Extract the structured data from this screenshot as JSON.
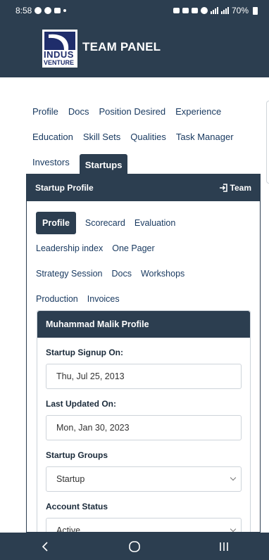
{
  "status_bar": {
    "time": "8:58",
    "battery": "70%"
  },
  "header": {
    "logo_line1": "INDUS",
    "logo_line2": "VENTURE",
    "title": "TEAM PANEL",
    "brand_color": "#2c3e50"
  },
  "top_tabs": {
    "row1": [
      "Profile",
      "Docs",
      "Position Desired",
      "Experience"
    ],
    "row2": [
      "Education",
      "Skill Sets",
      "Qualities",
      "Task Manager"
    ],
    "row3": [
      "Investors",
      "Startups"
    ],
    "active": "Startups"
  },
  "panel": {
    "title": "Startup Profile",
    "team_link": "Team"
  },
  "sub_tabs": {
    "row1": [
      "Profile",
      "Scorecard",
      "Evaluation"
    ],
    "row2": [
      "Leadership index",
      "One Pager"
    ],
    "row3": [
      "Strategy Session",
      "Docs",
      "Workshops"
    ],
    "row4": [
      "Production",
      "Invoices"
    ],
    "active": "Profile"
  },
  "card": {
    "title": "Muhammad Malik Profile",
    "fields": [
      {
        "label": "Startup Signup On:",
        "value": "Thu, Jul 25, 2013"
      },
      {
        "label": "Last Updated On:",
        "value": "Mon, Jan 30, 2023"
      },
      {
        "label": "Startup Groups",
        "value": "Startup"
      },
      {
        "label": "Account Status",
        "value": "Active"
      }
    ]
  },
  "nav": {
    "back_icon": "chevron-left",
    "home_icon": "circle",
    "recents_icon": "three-bars"
  }
}
